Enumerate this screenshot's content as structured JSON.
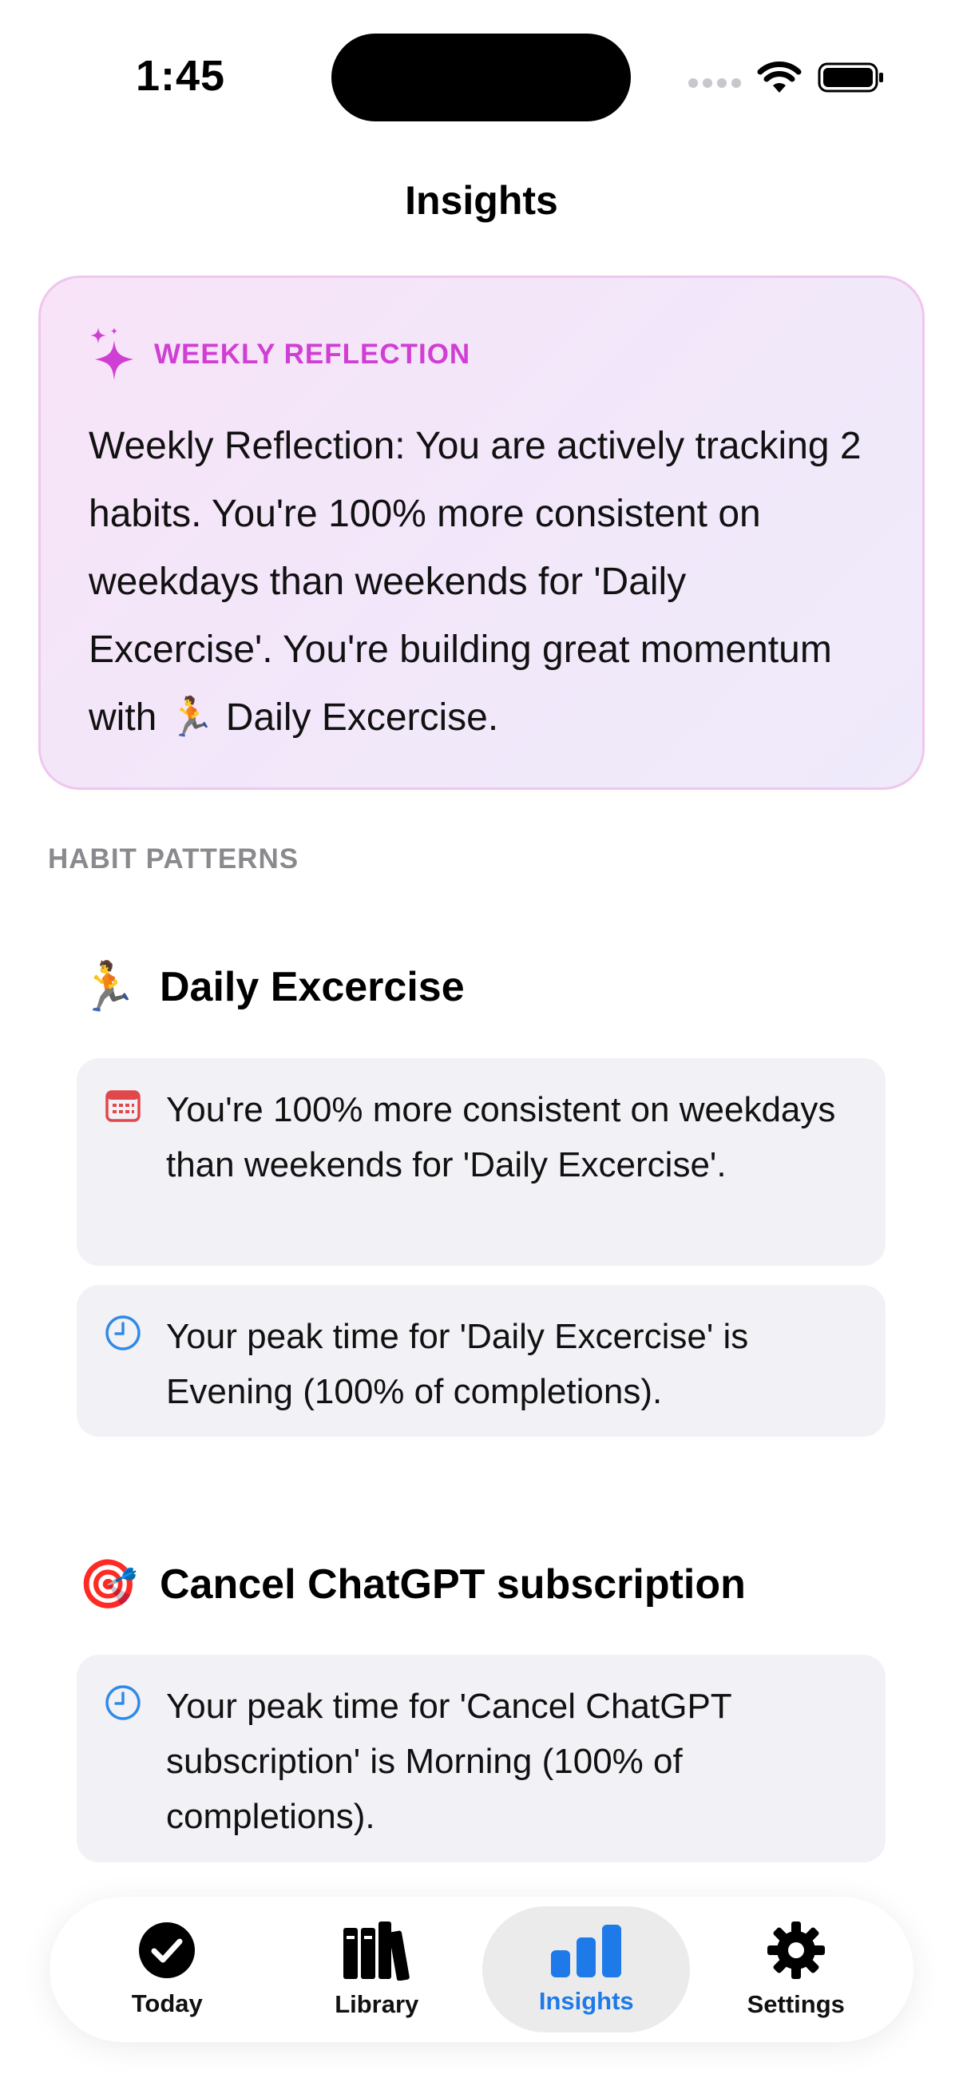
{
  "status": {
    "time": "1:45"
  },
  "nav": {
    "title": "Insights"
  },
  "reflection": {
    "label": "WEEKLY REFLECTION",
    "text": "Weekly Reflection: You are actively tracking 2 habits. You're 100% more consistent on weekdays than weekends for 'Daily Excercise'. You're building great momentum with 🏃 Daily Excercise.",
    "accent_color": "#d03fd4"
  },
  "patterns": {
    "header": "HABIT PATTERNS",
    "habits": [
      {
        "emoji": "🏃",
        "name": "Daily Excercise",
        "insights": [
          {
            "icon": "calendar-icon",
            "text": "You're 100% more consistent on weekdays than weekends for 'Daily Excercise'."
          },
          {
            "icon": "clock-icon",
            "text": "Your peak time for 'Daily Excercise' is Evening (100% of completions)."
          }
        ]
      },
      {
        "emoji": "🎯",
        "name": "Cancel ChatGPT subscription",
        "insights": [
          {
            "icon": "clock-icon",
            "text": "Your peak time for 'Cancel ChatGPT subscription' is Morning (100% of completions)."
          }
        ]
      }
    ]
  },
  "tabs": [
    {
      "label": "Today",
      "icon": "checkmark-circle-icon",
      "active": false
    },
    {
      "label": "Library",
      "icon": "books-icon",
      "active": false
    },
    {
      "label": "Insights",
      "icon": "bar-chart-icon",
      "active": true
    },
    {
      "label": "Settings",
      "icon": "gear-icon",
      "active": false
    }
  ],
  "colors": {
    "active_tab": "#1e7ae8",
    "calendar_icon": "#e0484b",
    "clock_icon": "#2f8ae8"
  }
}
